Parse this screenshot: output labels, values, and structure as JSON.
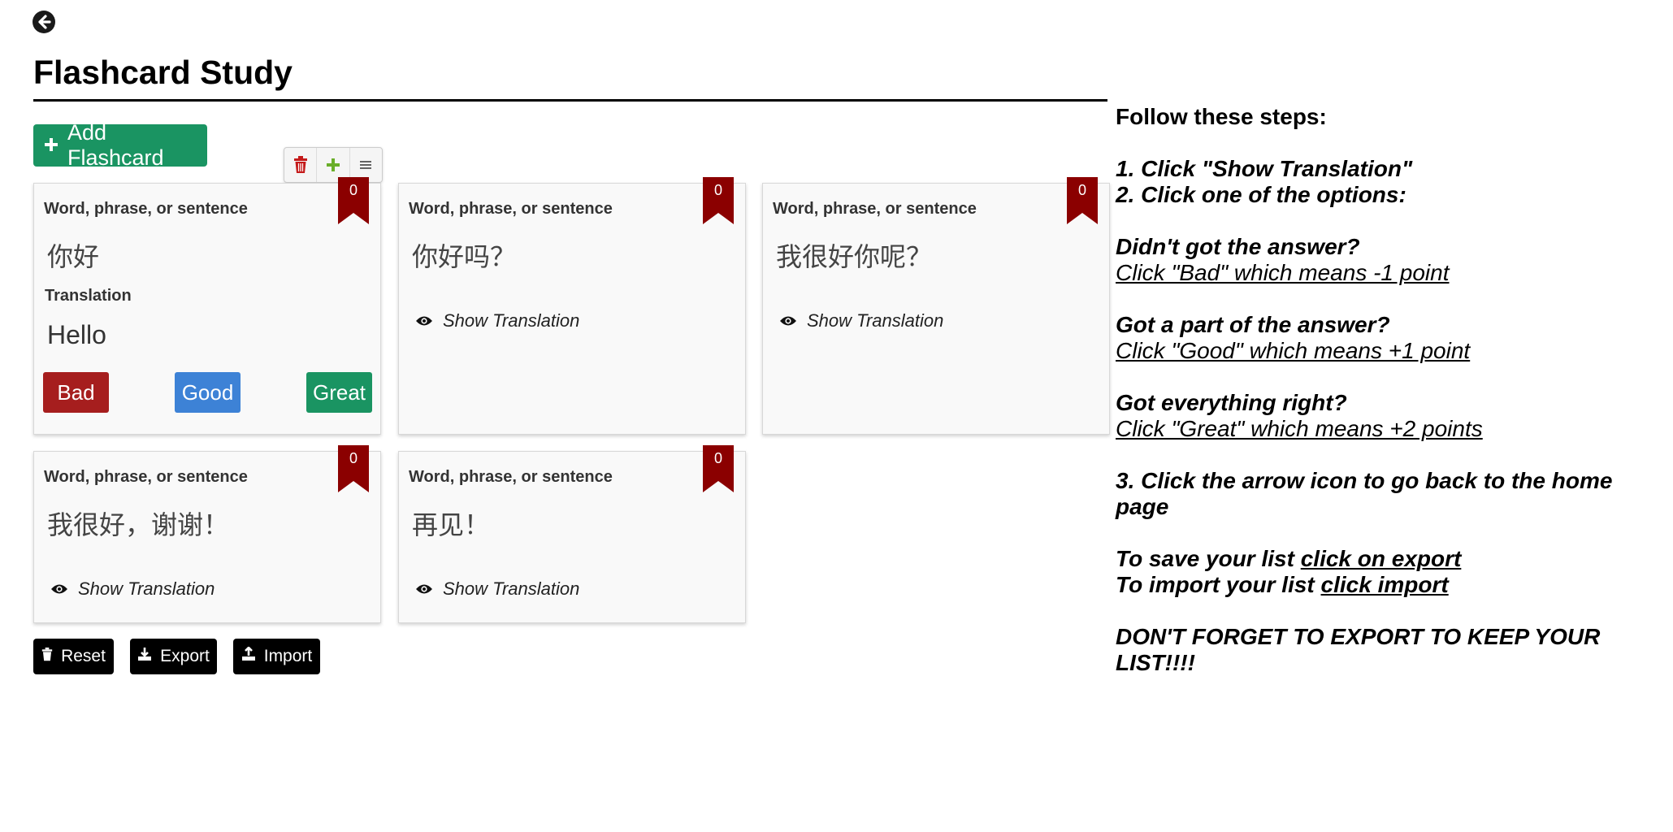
{
  "page": {
    "title": "Flashcard Study",
    "add_button_label": "Add Flashcard"
  },
  "colors": {
    "green": "#1a9462",
    "bad": "#a61e1e",
    "good": "#3d82d6",
    "ribbon": "#8b0000"
  },
  "cards": [
    {
      "label": "Word, phrase, or sentence",
      "word": "你好",
      "score": "0",
      "translation_label": "Translation",
      "translation": "Hello",
      "revealed": true
    },
    {
      "label": "Word, phrase, or sentence",
      "word": "你好吗？",
      "score": "0",
      "show_label": "Show Translation",
      "revealed": false
    },
    {
      "label": "Word, phrase, or sentence",
      "word": "我很好你呢？",
      "score": "0",
      "show_label": "Show Translation",
      "revealed": false
    },
    {
      "label": "Word, phrase, or sentence",
      "word": "我很好，谢谢！",
      "score": "0",
      "show_label": "Show Translation",
      "revealed": false
    },
    {
      "label": "Word, phrase, or sentence",
      "word": "再见！",
      "score": "0",
      "show_label": "Show Translation",
      "revealed": false
    }
  ],
  "rating": {
    "bad": "Bad",
    "good": "Good",
    "great": "Great"
  },
  "bottom_buttons": {
    "reset": "Reset",
    "export": "Export",
    "import": "Import"
  },
  "instructions": {
    "heading": "Follow these steps:",
    "step1": "1. Click \"Show Translation\"",
    "step2": "2. Click one of the options:",
    "q1": "Didn't got the answer?",
    "a1": "Click \"Bad\" which means -1 point",
    "q2": "Got a part of the answer?",
    "a2": "Click \"Good\" which means +1 point",
    "q3": "Got everything right?",
    "a3": "Click \"Great\" which means +2 points",
    "step3": "3. Click the arrow icon to go back to the home page",
    "save_prefix": "To save your list ",
    "save_link": "click on export",
    "import_prefix": "To import your list ",
    "import_link": "click import",
    "warning": "DON'T FORGET TO EXPORT TO KEEP YOUR LIST!!!!"
  }
}
